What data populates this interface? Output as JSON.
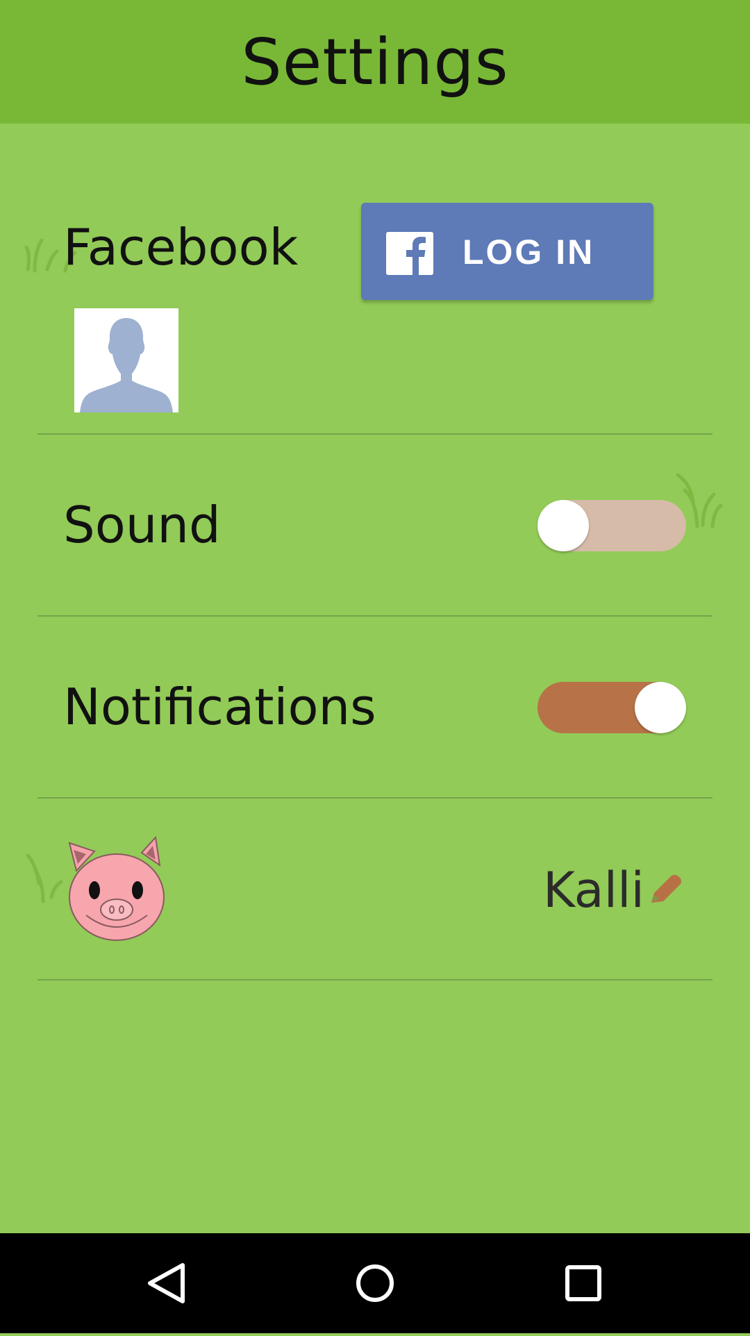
{
  "header": {
    "title": "Settings"
  },
  "facebook": {
    "label": "Facebook",
    "login_button": "LOG IN",
    "avatar_icon": "default-profile-silhouette"
  },
  "sound": {
    "label": "Sound",
    "enabled": false
  },
  "notifications": {
    "label": "Notifications",
    "enabled": true
  },
  "profile": {
    "name": "Kalli",
    "avatar_icon": "pig-face-icon",
    "edit_icon": "pencil-icon"
  },
  "navbar": {
    "icons": [
      "back-icon",
      "home-icon",
      "recents-icon"
    ]
  },
  "colors": {
    "header": "#78b836",
    "background": "#92cb57",
    "facebook_blue": "#5e7ab7",
    "toggle_off_track": "#d6bba9",
    "toggle_on_track": "#b77247",
    "pencil": "#b87144"
  }
}
